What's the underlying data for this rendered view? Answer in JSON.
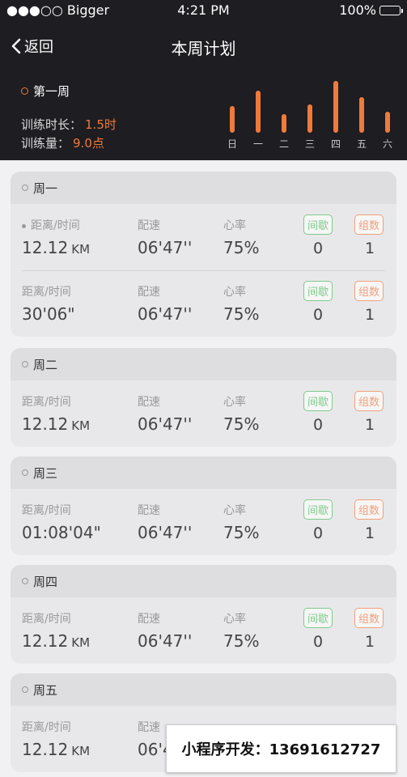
{
  "status": {
    "carrier": "●●●○○ Bigger",
    "time": "4:21 PM",
    "battery": "100%"
  },
  "nav": {
    "back_label": "返回",
    "title": "本周计划"
  },
  "summary": {
    "week_label": "第一周",
    "duration_label": "训练时长：",
    "duration_value": "1.5时",
    "volume_label": "训练量：",
    "volume_value": "9.0点"
  },
  "week_chart": {
    "days": [
      "日",
      "一",
      "二",
      "三",
      "四",
      "五",
      "六"
    ],
    "levels": [
      0.51,
      0.81,
      0.36,
      0.54,
      1.0,
      0.68,
      0.4
    ],
    "accent": "#f07a3a"
  },
  "labels": {
    "dist": "距离/时间",
    "pace": "配速",
    "hr": "心率",
    "interval": "间歇",
    "sets": "组数"
  },
  "days": [
    {
      "name": "周一",
      "rows": [
        {
          "dist": "12.12",
          "unit": "KM",
          "pace": "06'47''",
          "hr": "75%",
          "interval": "0",
          "sets": "1"
        },
        {
          "dist": "30'06\"",
          "unit": "",
          "pace": "06'47''",
          "hr": "75%",
          "interval": "0",
          "sets": "1"
        }
      ]
    },
    {
      "name": "周二",
      "rows": [
        {
          "dist": "12.12",
          "unit": "KM",
          "pace": "06'47''",
          "hr": "75%",
          "interval": "0",
          "sets": "1"
        }
      ]
    },
    {
      "name": "周三",
      "rows": [
        {
          "dist": "01:08'04\"",
          "unit": "",
          "pace": "06'47''",
          "hr": "75%",
          "interval": "0",
          "sets": "1"
        }
      ]
    },
    {
      "name": "周四",
      "rows": [
        {
          "dist": "12.12",
          "unit": "KM",
          "pace": "06'47''",
          "hr": "75%",
          "interval": "0",
          "sets": "1"
        }
      ]
    },
    {
      "name": "周五",
      "rows": [
        {
          "dist": "12.12",
          "unit": "KM",
          "pace": "06'4",
          "hr": "",
          "interval": "",
          "sets": ""
        }
      ]
    }
  ],
  "banner": {
    "text": "小程序开发：13691612727"
  }
}
